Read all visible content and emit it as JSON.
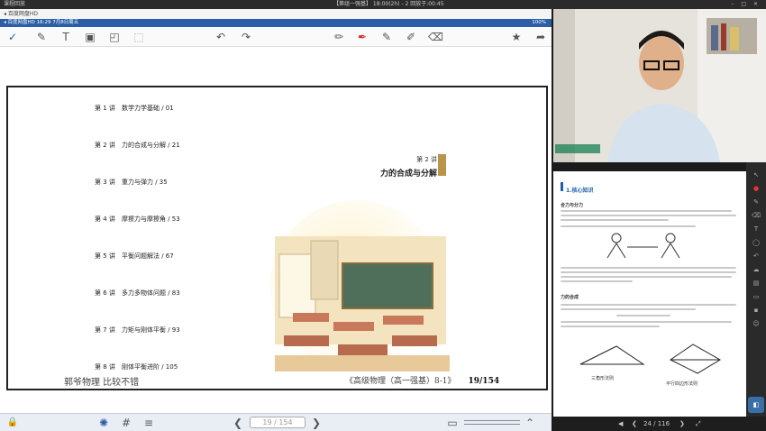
{
  "system_bar": {
    "left": "课程回放",
    "center": "【第组一强基】 18:00(2h) - 2  回放于:00:45",
    "right": "–   □   ×"
  },
  "tab": {
    "title": "◂ 百度网盘HD"
  },
  "status": {
    "left": "◂ 百度网盘HD   16:29  7月8日周五",
    "right": "100%"
  },
  "toc": [
    {
      "num": "第 1 讲",
      "title": "数学力学基础  / 01"
    },
    {
      "num": "第 2 讲",
      "title": "力的合成与分解  / 21"
    },
    {
      "num": "第 3 讲",
      "title": "重力与弹力  / 35"
    },
    {
      "num": "第 4 讲",
      "title": "摩擦力与摩擦角  / 53"
    },
    {
      "num": "第 5 讲",
      "title": "平衡问题解法  / 67"
    },
    {
      "num": "第 6 讲",
      "title": "多力多物体问题  / 83"
    },
    {
      "num": "第 7 讲",
      "title": "力矩与刚体平衡  / 93"
    },
    {
      "num": "第 8 讲",
      "title": "刚体平衡进阶  / 105"
    }
  ],
  "chapter": {
    "label": "第 2 讲",
    "title": "力的合成与分解"
  },
  "footer": {
    "left": "郭爷物理  比较不错",
    "right": "《高级物理（高一强基）8-1》",
    "page": "19/154"
  },
  "pager": {
    "value": "19 / 154"
  },
  "doc": {
    "heading": "1.核心知识",
    "sec1": "合力与分力",
    "sec2": "力的合成",
    "diagram1": "三角形法则",
    "diagram2": "平行四边形法则"
  },
  "doc_pager": {
    "value": "24 / 116"
  },
  "colors": {
    "accent": "#2a5fa8",
    "chapter_bar": "#b9944a"
  }
}
